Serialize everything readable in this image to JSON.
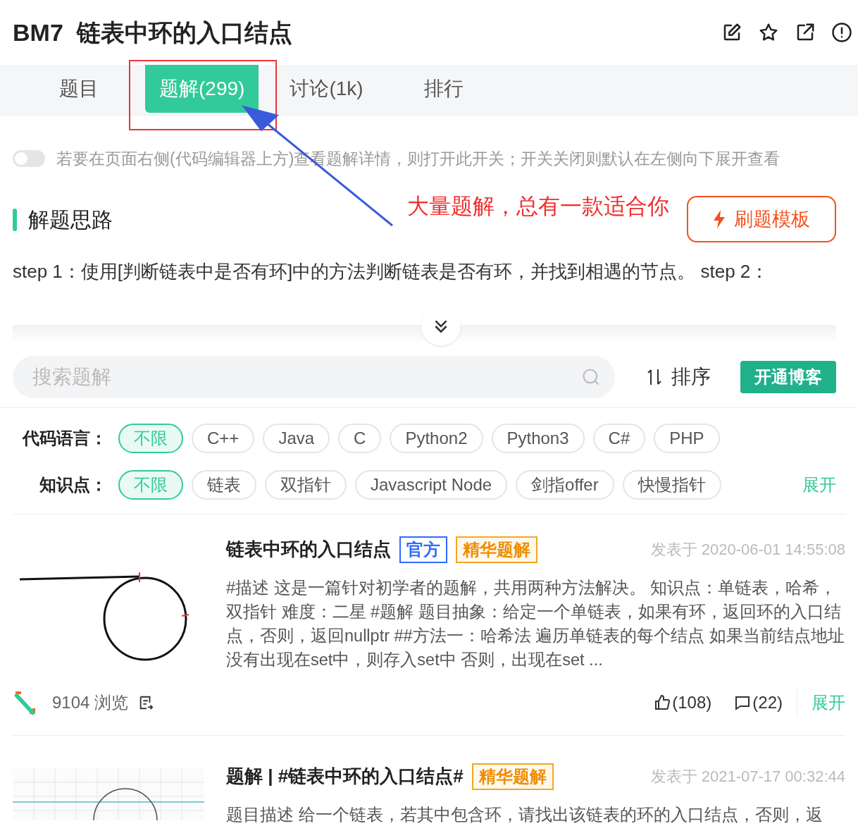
{
  "title": {
    "code": "BM7",
    "name": "链表中环的入口结点"
  },
  "tabs": [
    {
      "label": "题目",
      "selected": false
    },
    {
      "label": "题解(299)",
      "selected": true
    },
    {
      "label": "讨论(1k)",
      "selected": false
    },
    {
      "label": "排行",
      "selected": false
    }
  ],
  "toggle": {
    "on": false,
    "label": "若要在页面右侧(代码编辑器上方)查看题解详情，则打开此开关；开关关闭则默认在左侧向下展开查看"
  },
  "annotation": {
    "callout": "大量题解，总有一款适合你"
  },
  "section": {
    "heading": "解题思路",
    "template_button": "刷题模板",
    "text": "step 1：使用[判断链表中是否有环]中的方法判断链表是否有环，并找到相遇的节点。 step 2："
  },
  "search": {
    "placeholder": "搜索题解"
  },
  "sort_label": "排序",
  "blog_button": "开通博客",
  "filters": [
    {
      "label": "代码语言：",
      "options": [
        {
          "label": "不限",
          "selected": true
        },
        {
          "label": "C++",
          "selected": false
        },
        {
          "label": "Java",
          "selected": false
        },
        {
          "label": "C",
          "selected": false
        },
        {
          "label": "Python2",
          "selected": false
        },
        {
          "label": "Python3",
          "selected": false
        },
        {
          "label": "C#",
          "selected": false
        },
        {
          "label": "PHP",
          "selected": false
        }
      ]
    },
    {
      "label": "知识点：",
      "options": [
        {
          "label": "不限",
          "selected": true
        },
        {
          "label": "链表",
          "selected": false
        },
        {
          "label": "双指针",
          "selected": false
        },
        {
          "label": "Javascript Node",
          "selected": false
        },
        {
          "label": "剑指offer",
          "selected": false
        },
        {
          "label": "快慢指针",
          "selected": false
        }
      ],
      "more": "展开"
    }
  ],
  "posts": [
    {
      "title": "链表中环的入口结点",
      "badges": [
        {
          "label": "官方",
          "kind": "official"
        },
        {
          "label": "精华题解",
          "kind": "featured"
        }
      ],
      "date": "发表于 2020-06-01 14:55:08",
      "excerpt": "#描述 这是一篇针对初学者的题解，共用两种方法解决。 知识点：单链表，哈希，双指针 难度：二星 #题解 题目抽象：给定一个单链表，如果有环，返回环的入口结点，否则，返回nullptr ##方法一：哈希法 遍历单链表的每个结点 如果当前结点地址没有出现在set中，则存入set中 否则，出现在set ...",
      "views": "9104 浏览",
      "likes": "(108)",
      "comments": "(22)",
      "expand": "展开"
    },
    {
      "title": "题解 | #链表中环的入口结点#",
      "badges": [
        {
          "label": "精华题解",
          "kind": "featured"
        }
      ],
      "date": "发表于 2021-07-17 00:32:44",
      "excerpt": "题目描述 给一个链表，若其中包含环，请找出该链表的环的入口结点，否则，返"
    }
  ]
}
